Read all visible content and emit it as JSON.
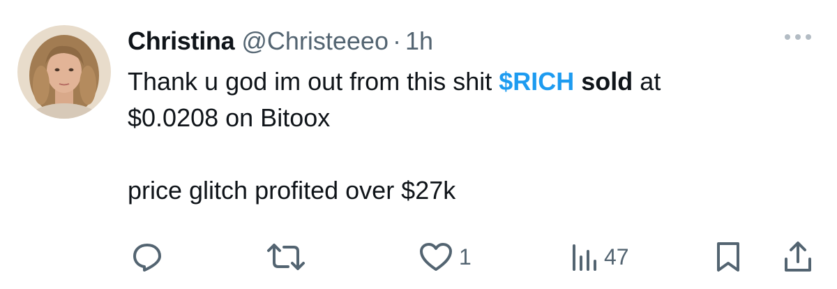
{
  "tweet": {
    "author_name": "Christina",
    "author_handle": "@Christeeeo",
    "separator": "·",
    "timestamp": "1h",
    "body": {
      "line1_prefix": "Thank u god im out from this shit ",
      "cashtag": "$RICH",
      "line1_space": " ",
      "bold_word": "sold",
      "line1_suffix": " at",
      "line2": "$0.0208 on Bitoox",
      "line3": "price glitch profited over $27k"
    },
    "actions": {
      "reply_icon": "reply-icon",
      "retweet_icon": "retweet-icon",
      "like_icon": "like-icon",
      "like_count": "1",
      "views_icon": "views-icon",
      "view_count": "47",
      "bookmark_icon": "bookmark-icon",
      "share_icon": "share-icon"
    },
    "more_icon": "more-icon",
    "colors": {
      "text": "#0f1419",
      "secondary": "#536471",
      "link": "#1d9bf0"
    }
  }
}
